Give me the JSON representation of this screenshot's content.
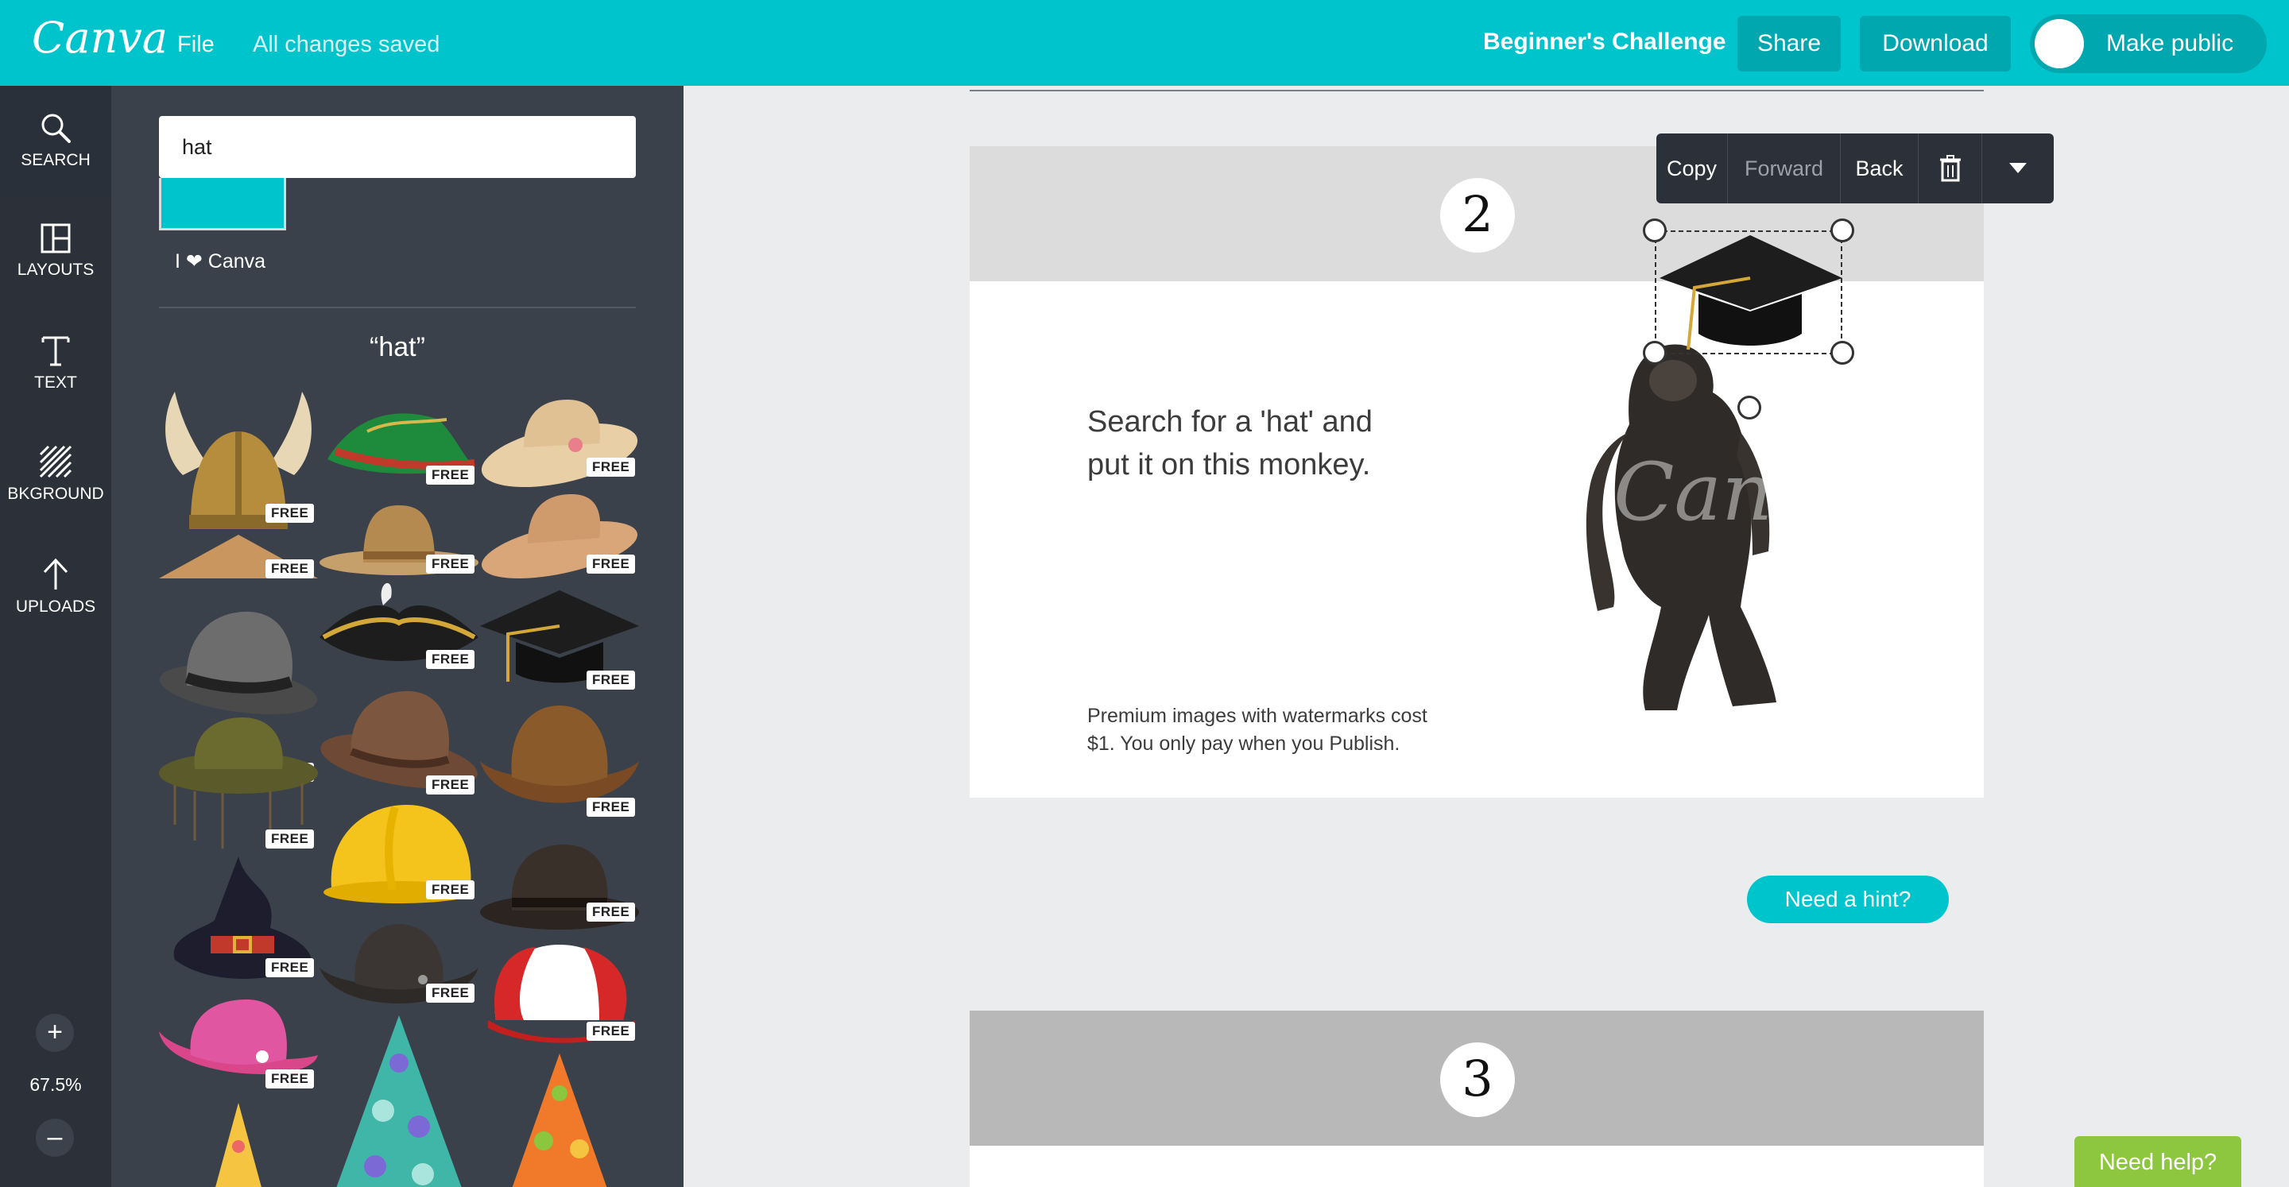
{
  "topbar": {
    "logo": "Canva",
    "file_label": "File",
    "save_status": "All changes saved",
    "design_title": "Beginner's Challenge",
    "share_label": "Share",
    "download_label": "Download",
    "public_label": "Make public",
    "public_on": false
  },
  "rail": {
    "items": [
      {
        "label": "SEARCH",
        "icon": "search-icon"
      },
      {
        "label": "LAYOUTS",
        "icon": "layout-icon"
      },
      {
        "label": "TEXT",
        "icon": "text-icon"
      },
      {
        "label": "BKGROUND",
        "icon": "background-icon"
      },
      {
        "label": "UPLOADS",
        "icon": "upload-icon"
      }
    ],
    "zoom_in": "+",
    "zoom_level": "67.5%",
    "zoom_out": "–"
  },
  "panel": {
    "search_value": "hat",
    "canva_line": "I ❤ Canva",
    "results_title": "“hat”",
    "free_label": "FREE",
    "hats": [
      "viking-helmet",
      "green-feather-hat",
      "straw-sun-hat",
      "conical-straw-hat",
      "sombrero",
      "wide-brim-straw-hat",
      "grey-fedora",
      "pirate-hat",
      "graduation-cap",
      "cork-hat",
      "brown-fedora",
      "cowboy-hat",
      "witch-hat",
      "hard-hat",
      "bowler-hat",
      "pink-cowboy-hat",
      "black-cowboy-hat",
      "baseball-cap",
      "party-hat",
      "party-hat",
      "party-hat"
    ]
  },
  "editor": {
    "context_toolbar": {
      "copy_label": "Copy",
      "forward_label": "Forward",
      "back_label": "Back"
    },
    "page2": {
      "number": "2",
      "instruction": "Search for a 'hat' and put it on this monkey.",
      "note": "Premium images with watermarks cost $1. You only pay when you Publish.",
      "watermark": "Canva",
      "hint_label": "Need a hint?"
    },
    "page3": {
      "number": "3"
    }
  },
  "help": {
    "label": "Need help?"
  },
  "colors": {
    "brand": "#00c4cc",
    "dark_rail": "#293039",
    "panel": "#3b414a",
    "help": "#8dc63f"
  }
}
